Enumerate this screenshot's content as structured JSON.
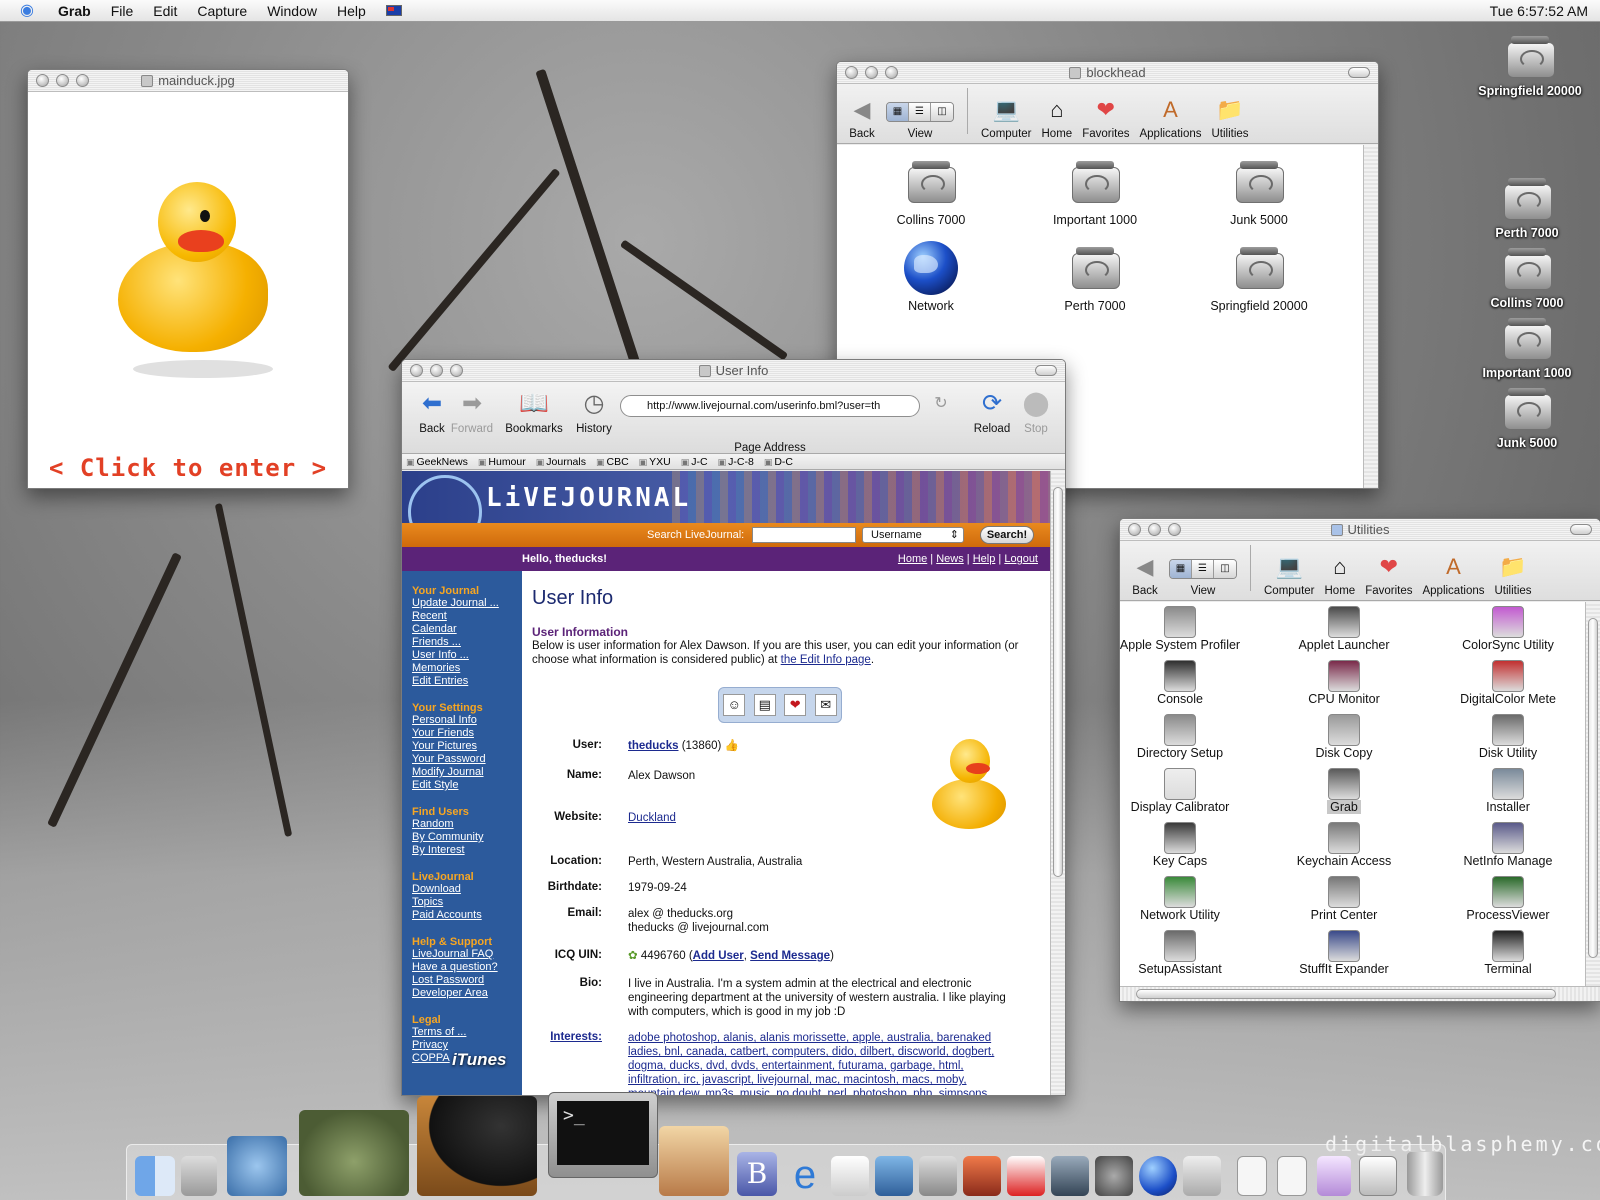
{
  "menubar": {
    "apple_icon": "apple-icon",
    "app": "Grab",
    "items": [
      "File",
      "Edit",
      "Capture",
      "Window",
      "Help"
    ],
    "clock": "Tue 6:57:52 AM"
  },
  "duck_window": {
    "title": "mainduck.jpg",
    "click_text": "< Click to enter >"
  },
  "blockhead": {
    "title": "blockhead",
    "toolbar": [
      "Back",
      "View",
      "Computer",
      "Home",
      "Favorites",
      "Applications",
      "Utilities"
    ],
    "icons": [
      "Collins 7000",
      "Important 1000",
      "Junk 5000",
      "Network",
      "Perth 7000",
      "Springfield 20000"
    ]
  },
  "utilities": {
    "title": "Utilities",
    "toolbar": [
      "Back",
      "View",
      "Computer",
      "Home",
      "Favorites",
      "Applications",
      "Utilities"
    ],
    "apps": [
      "Apple System Profiler",
      "Applet Launcher",
      "ColorSync Utility",
      "Console",
      "CPU Monitor",
      "DigitalColor Mete",
      "Directory Setup",
      "Disk Copy",
      "Disk Utility",
      "Display Calibrator",
      "Grab",
      "Installer",
      "Key Caps",
      "Keychain Access",
      "NetInfo Manage",
      "Network Utility",
      "Print Center",
      "ProcessViewer",
      "SetupAssistant",
      "StuffIt Expander",
      "Terminal"
    ],
    "selected": "Grab"
  },
  "browser": {
    "title": "User Info",
    "buttons": {
      "back": "Back",
      "forward": "Forward",
      "bookmarks": "Bookmarks",
      "history": "History",
      "reload": "Reload",
      "stop": "Stop"
    },
    "address": "http://www.livejournal.com/userinfo.bml?user=th",
    "address_label": "Page Address",
    "favorites": [
      "GeekNews",
      "Humour",
      "Journals",
      "CBC",
      "YXU",
      "J-C",
      "J-C-8",
      "D-C"
    ]
  },
  "lj": {
    "logo": "LiVEJOURNAL",
    "search_label": "Search LiveJournal:",
    "search_select": "Username",
    "search_button": "Search!",
    "hello": "Hello, theducks!",
    "nav": [
      "Home",
      "News",
      "Help",
      "Logout"
    ],
    "sidebar": [
      {
        "heading": "Your Journal",
        "links": [
          "Update Journal ...",
          "Recent",
          "Calendar",
          "Friends ...",
          "User Info ...",
          "Memories",
          "Edit Entries"
        ]
      },
      {
        "heading": "Your Settings",
        "links": [
          "Personal Info",
          "Your Friends",
          "Your Pictures",
          "Your Password",
          "Modify Journal",
          "Edit Style"
        ]
      },
      {
        "heading": "Find Users",
        "links": [
          "Random",
          "By Community",
          "By Interest"
        ]
      },
      {
        "heading": "LiveJournal",
        "links": [
          "Download",
          "Topics",
          "Paid Accounts"
        ]
      },
      {
        "heading": "Help & Support",
        "links": [
          "LiveJournal FAQ",
          "Have a question?",
          "Lost Password",
          "Developer Area"
        ]
      },
      {
        "heading": "Legal",
        "links": [
          "Terms of ...",
          "Privacy",
          "COPPA"
        ]
      }
    ],
    "page_title": "User Info",
    "section_title": "User Information",
    "intro_text": "Below is user information for Alex Dawson. If you are this user, you can edit your information (or choose what information is considered public) at",
    "intro_link": "the Edit Info page",
    "fields": {
      "user_label": "User:",
      "user": "theducks",
      "user_id": "(13860)",
      "name_label": "Name:",
      "name": "Alex Dawson",
      "website_label": "Website:",
      "website": "Duckland",
      "location_label": "Location:",
      "location": "Perth, Western Australia, Australia",
      "birthdate_label": "Birthdate:",
      "birthdate": "1979-09-24",
      "email_label": "Email:",
      "email1": "alex @ theducks.org",
      "email2": "theducks @ livejournal.com",
      "icq_label": "ICQ UIN:",
      "icq": "4496760",
      "icq_add": "Add User",
      "icq_msg": "Send Message",
      "bio_label": "Bio:",
      "bio": "I live in Australia. I'm a system admin at the electrical and electronic engineering department at the university of western australia. I like playing with computers, which is good in my job :D",
      "interests_label": "Interests:",
      "interests": "adobe photoshop, alanis, alanis morissette, apple, australia, barenaked ladies, bnl, canada, catbert, computers, dido, dilbert, discworld, dogbert, dogma, ducks, dvd, dvds, entertainment, futurama, garbage, html, infiltration, irc, javascript, livejournal, mac, macintosh, macs, moby, mountain dew, mp3s, music, no doubt, perl, photoshop, php, simpsons,"
    }
  },
  "desktop_icons": [
    "Springfield 20000",
    "Perth 7000",
    "Collins 7000",
    "Important 1000",
    "Junk 5000"
  ],
  "dock": {
    "itunes_label": "iTunes",
    "terminal_prompt": ">_"
  },
  "watermark": "digitalblasphemy.com"
}
